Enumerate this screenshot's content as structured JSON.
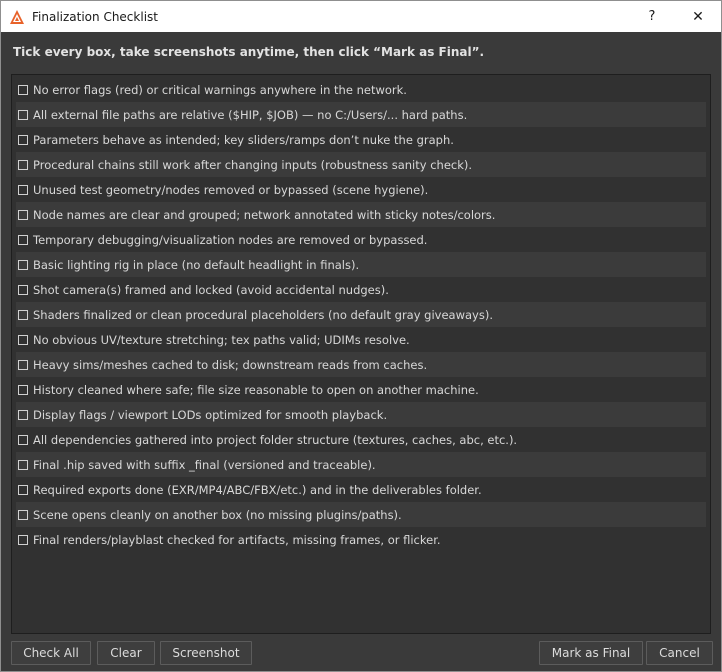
{
  "window": {
    "title": "Finalization Checklist",
    "help_label": "?",
    "close_label": "✕"
  },
  "instruction": "Tick every box, take screenshots anytime, then click “Mark as Final”.",
  "checklist": [
    {
      "label": "No error flags (red) or critical warnings anywhere in the network.",
      "checked": false
    },
    {
      "label": "All external file paths are relative ($HIP, $JOB) — no C:/Users/... hard paths.",
      "checked": false
    },
    {
      "label": "Parameters behave as intended; key sliders/ramps don’t nuke the graph.",
      "checked": false
    },
    {
      "label": "Procedural chains still work after changing inputs (robustness sanity check).",
      "checked": false
    },
    {
      "label": "Unused test geometry/nodes removed or bypassed (scene hygiene).",
      "checked": false
    },
    {
      "label": "Node names are clear and grouped; network annotated with sticky notes/colors.",
      "checked": false
    },
    {
      "label": "Temporary debugging/visualization nodes are removed or bypassed.",
      "checked": false
    },
    {
      "label": "Basic lighting rig in place (no default headlight in finals).",
      "checked": false
    },
    {
      "label": "Shot camera(s) framed and locked (avoid accidental nudges).",
      "checked": false
    },
    {
      "label": "Shaders finalized or clean procedural placeholders (no default gray giveaways).",
      "checked": false
    },
    {
      "label": "No obvious UV/texture stretching; tex paths valid; UDIMs resolve.",
      "checked": false
    },
    {
      "label": "Heavy sims/meshes cached to disk; downstream reads from caches.",
      "checked": false
    },
    {
      "label": "History cleaned where safe; file size reasonable to open on another machine.",
      "checked": false
    },
    {
      "label": "Display flags / viewport LODs optimized for smooth playback.",
      "checked": false
    },
    {
      "label": "All dependencies gathered into project folder structure (textures, caches, abc, etc.).",
      "checked": false
    },
    {
      "label": "Final .hip saved with suffix _final (versioned and traceable).",
      "checked": false
    },
    {
      "label": "Required exports done (EXR/MP4/ABC/FBX/etc.) and in the deliverables folder.",
      "checked": false
    },
    {
      "label": "Scene opens cleanly on another box (no missing plugins/paths).",
      "checked": false
    },
    {
      "label": "Final renders/playblast checked for artifacts, missing frames, or flicker.",
      "checked": false
    }
  ],
  "buttons": {
    "check_all": "Check All",
    "clear": "Clear",
    "screenshot": "Screenshot",
    "mark_final": "Mark as Final",
    "cancel": "Cancel"
  },
  "colors": {
    "app_icon": "#e8622a",
    "background": "#3a3a3a",
    "list_background": "#313131",
    "row_alt": "#3b3b3b",
    "text": "#d8d8d8"
  },
  "icons": {
    "app": "houdini-logo-icon",
    "help": "help-icon",
    "close": "close-icon",
    "checkbox": "checkbox-unchecked-icon"
  }
}
